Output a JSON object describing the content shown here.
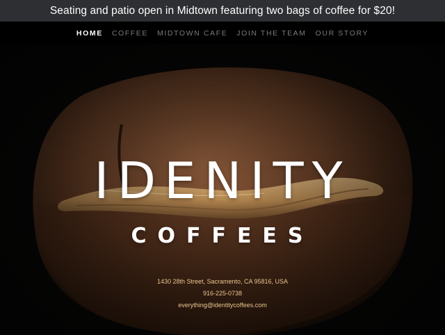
{
  "announcement": "Seating and patio open in Midtown featuring two bags of coffee for $20!",
  "nav": {
    "items": [
      {
        "label": "HOME",
        "active": true
      },
      {
        "label": "COFFEE",
        "active": false
      },
      {
        "label": "MIDTOWN CAFE",
        "active": false
      },
      {
        "label": "JOIN THE TEAM",
        "active": false
      },
      {
        "label": "OUR STORY",
        "active": false
      }
    ]
  },
  "hero": {
    "title": "IDENITY",
    "subtitle": "COFFEES",
    "background_image": "coffee-bean-closeup"
  },
  "contact": {
    "address": "1430 28th Street, Sacramento, CA 95816, USA",
    "phone": "916-225-0738",
    "email": "everything@identitycoffees.com"
  },
  "colors": {
    "announcement_bg": "#2e2f33",
    "nav_bg": "#000000",
    "nav_active": "#ffffff",
    "nav_inactive": "#7b7b7b",
    "contact_text": "#e9c48f"
  }
}
